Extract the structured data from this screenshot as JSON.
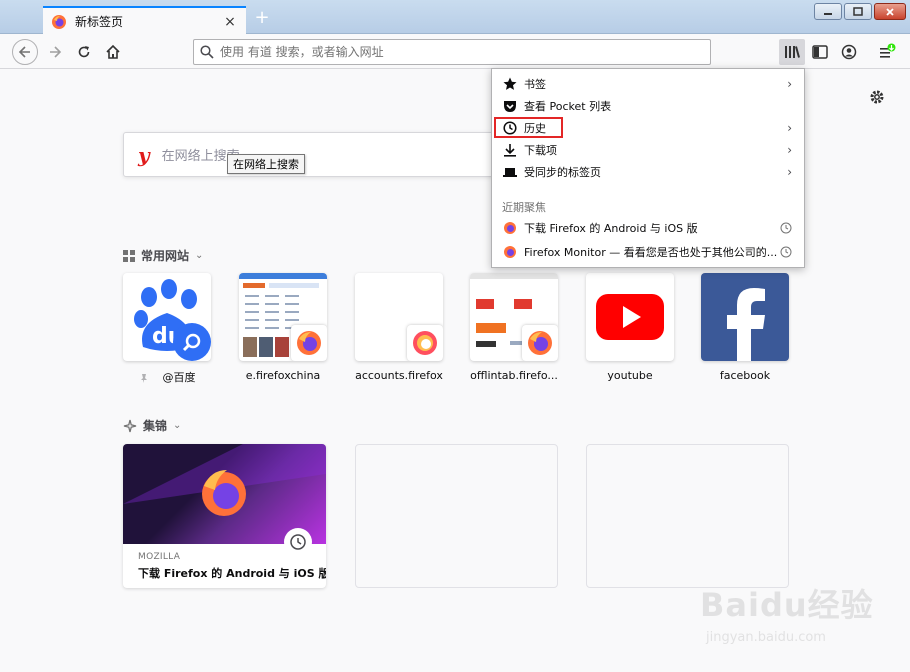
{
  "window": {
    "tab_title": "新标签页",
    "tab_close": "×",
    "new_tab": "+"
  },
  "toolbar": {
    "url_placeholder": "使用 有道 搜索，或者输入网址"
  },
  "search": {
    "placeholder": "在网络上搜索",
    "tooltip": "在网络上搜索"
  },
  "top_sites": {
    "title": "常用网站",
    "sites": [
      {
        "label": "@百度"
      },
      {
        "label": "e.firefoxchina"
      },
      {
        "label": "accounts.firefox"
      },
      {
        "label": "offlintab.firefo..."
      },
      {
        "label": "youtube"
      },
      {
        "label": "facebook"
      }
    ]
  },
  "highlights": {
    "title": "集锦",
    "cards": [
      {
        "source": "MOZILLA",
        "title": "下载 Firefox 的 Android 与 iOS 版"
      }
    ]
  },
  "library_menu": {
    "items": [
      {
        "label": "书签",
        "icon": "star-icon"
      },
      {
        "label": "查看 Pocket 列表",
        "icon": "pocket-icon"
      },
      {
        "label": "历史",
        "icon": "clock-icon"
      },
      {
        "label": "下载项",
        "icon": "download-icon"
      },
      {
        "label": "受同步的标签页",
        "icon": "synced-tabs-icon"
      }
    ],
    "recent_header": "近期聚焦",
    "recent": [
      {
        "label": "下载 Firefox 的 Android 与 iOS 版"
      },
      {
        "label": "Firefox Monitor — 看看您是否也处于其他公司的..."
      }
    ]
  },
  "watermark": {
    "brand": "Baidu经验",
    "url": "jingyan.baidu.com"
  },
  "colors": {
    "accent": "#0a84ff",
    "highlight_box": "#e32626",
    "firefox_orange": "#ff7139"
  }
}
